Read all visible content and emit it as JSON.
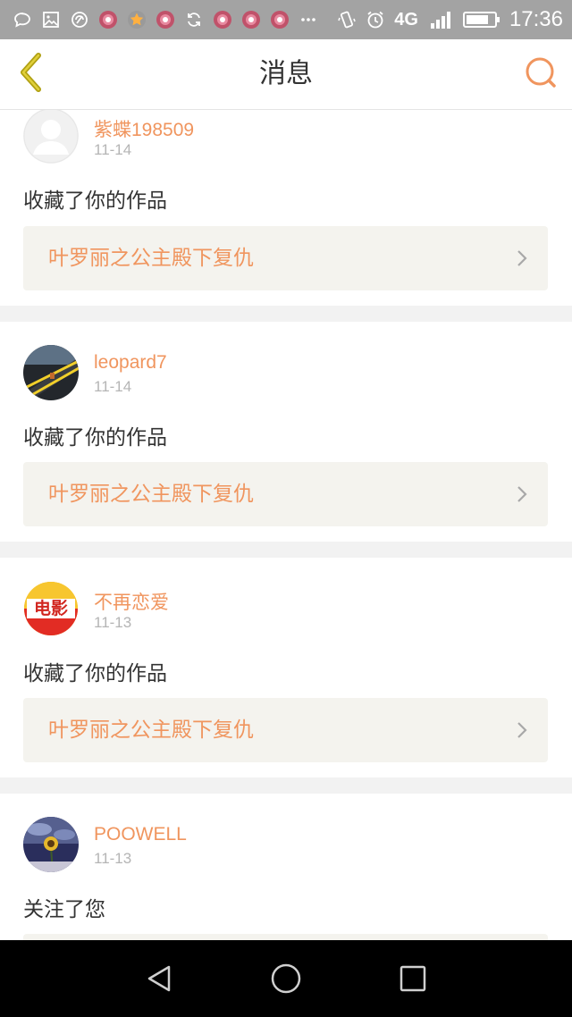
{
  "status_bar": {
    "time": "17:36",
    "network": "4G",
    "icons": [
      "message-icon",
      "image-icon",
      "vpn-icon",
      "app-icon",
      "star-icon",
      "app-icon",
      "sync-icon",
      "app-icon",
      "app-icon",
      "app-icon",
      "more-icon",
      "vibrate-icon",
      "alarm-icon",
      "signal-icon",
      "battery-icon"
    ]
  },
  "header": {
    "title": "消息",
    "back_icon": "chevron-left-icon",
    "search_icon": "search-icon",
    "accent_color": "#f0955e"
  },
  "messages": [
    {
      "user": "紫蝶198509",
      "time": "11-14",
      "action": "收藏了你的作品",
      "work": "叶罗丽之公主殿下复仇",
      "avatar": "default-avatar"
    },
    {
      "user": "leopard7",
      "time": "11-14",
      "action": "收藏了你的作品",
      "work": "叶罗丽之公主殿下复仇",
      "avatar": "road-avatar"
    },
    {
      "user": "不再恋爱",
      "time": "11-13",
      "action": "收藏了你的作品",
      "work": "叶罗丽之公主殿下复仇",
      "avatar": "movie-avatar",
      "avatar_text": "电影"
    },
    {
      "user": "POOWELL",
      "time": "11-13",
      "action": "关注了您",
      "avatar": "sunflower-avatar"
    }
  ],
  "nav_bar": {
    "back": "nav-back-icon",
    "home": "nav-home-icon",
    "recents": "nav-recents-icon"
  }
}
